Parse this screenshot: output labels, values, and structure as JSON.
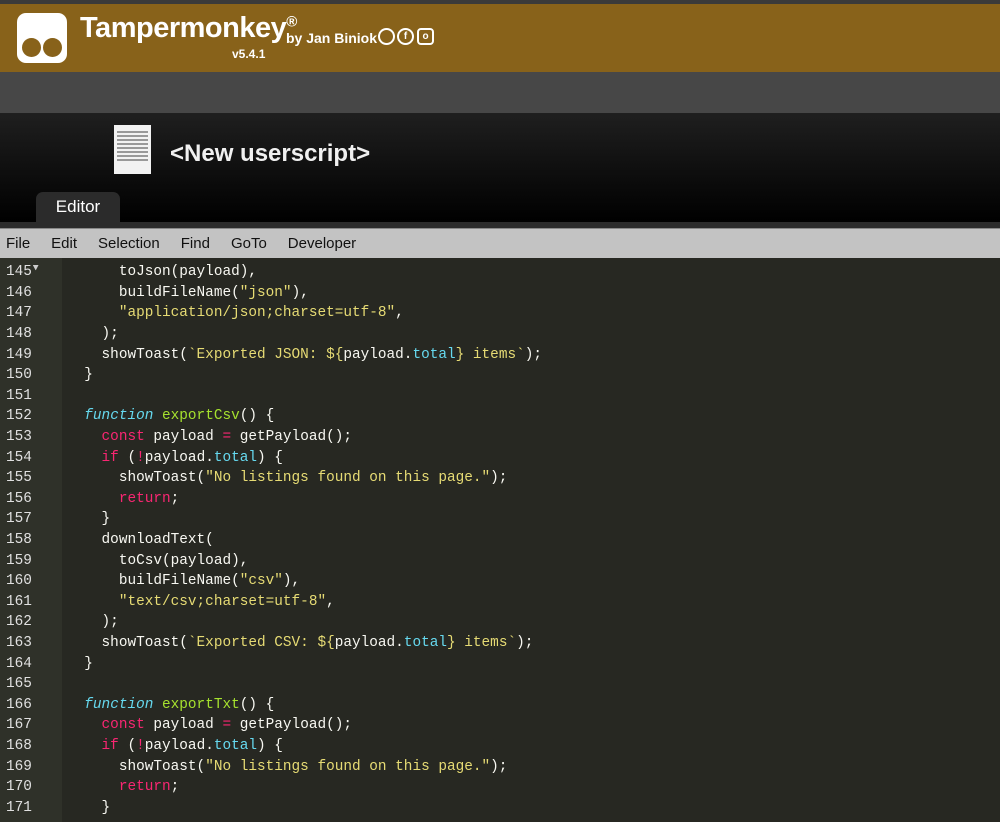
{
  "header": {
    "app_name": "Tampermonkey",
    "registered": "®",
    "byline": "by Jan Biniok",
    "version": "v5.4.1",
    "social": [
      "github-icon",
      "facebook-icon",
      "instagram-icon"
    ]
  },
  "script": {
    "name": "<New userscript>"
  },
  "tabs": [
    {
      "label": "Editor",
      "active": true
    }
  ],
  "menu": [
    "File",
    "Edit",
    "Selection",
    "Find",
    "GoTo",
    "Developer"
  ],
  "colors": {
    "header": "#88621a",
    "editor_bg": "#272822",
    "string": "#e6db74",
    "keyword": "#f92672",
    "function": "#a6e22e",
    "property": "#66d9ef"
  },
  "code": [
    {
      "n": "145",
      "i": 6,
      "t": [
        [
          "",
          "toJson(payload),"
        ]
      ]
    },
    {
      "n": "146",
      "i": 6,
      "t": [
        [
          "",
          "buildFileName("
        ],
        [
          "str",
          "\"json\""
        ],
        [
          "",
          "),"
        ]
      ]
    },
    {
      "n": "147",
      "i": 6,
      "t": [
        [
          "str",
          "\"application/json;charset=utf-8\""
        ],
        [
          "",
          ","
        ]
      ]
    },
    {
      "n": "148",
      "i": 4,
      "t": [
        [
          "",
          ");"
        ]
      ]
    },
    {
      "n": "149",
      "i": 4,
      "t": [
        [
          "",
          "showToast("
        ],
        [
          "str",
          "`Exported JSON: ${"
        ],
        [
          "",
          "payload."
        ],
        [
          "prop",
          "total"
        ],
        [
          "str",
          "} items`"
        ],
        [
          "",
          ");"
        ]
      ]
    },
    {
      "n": "150",
      "i": 2,
      "t": [
        [
          "",
          "}"
        ]
      ]
    },
    {
      "n": "151",
      "i": 0,
      "t": []
    },
    {
      "n": "152",
      "i": 2,
      "fold": true,
      "t": [
        [
          "fnkw",
          "function"
        ],
        [
          "",
          " "
        ],
        [
          "fn",
          "exportCsv"
        ],
        [
          "",
          "() {"
        ]
      ]
    },
    {
      "n": "153",
      "i": 4,
      "t": [
        [
          "kw",
          "const"
        ],
        [
          "",
          " payload "
        ],
        [
          "kw",
          "="
        ],
        [
          "",
          " getPayload();"
        ]
      ]
    },
    {
      "n": "154",
      "i": 4,
      "fold": true,
      "t": [
        [
          "kw",
          "if"
        ],
        [
          "",
          " ("
        ],
        [
          "kw",
          "!"
        ],
        [
          "",
          "payload."
        ],
        [
          "prop",
          "total"
        ],
        [
          "",
          ") {"
        ]
      ]
    },
    {
      "n": "155",
      "i": 6,
      "t": [
        [
          "",
          "showToast("
        ],
        [
          "str",
          "\"No listings found on this page.\""
        ],
        [
          "",
          ");"
        ]
      ]
    },
    {
      "n": "156",
      "i": 6,
      "t": [
        [
          "kw",
          "return"
        ],
        [
          "",
          ";"
        ]
      ]
    },
    {
      "n": "157",
      "i": 4,
      "t": [
        [
          "",
          "}"
        ]
      ]
    },
    {
      "n": "158",
      "i": 4,
      "t": [
        [
          "",
          "downloadText("
        ]
      ]
    },
    {
      "n": "159",
      "i": 6,
      "t": [
        [
          "",
          "toCsv(payload),"
        ]
      ]
    },
    {
      "n": "160",
      "i": 6,
      "t": [
        [
          "",
          "buildFileName("
        ],
        [
          "str",
          "\"csv\""
        ],
        [
          "",
          "),"
        ]
      ]
    },
    {
      "n": "161",
      "i": 6,
      "t": [
        [
          "str",
          "\"text/csv;charset=utf-8\""
        ],
        [
          "",
          ","
        ]
      ]
    },
    {
      "n": "162",
      "i": 4,
      "t": [
        [
          "",
          ");"
        ]
      ]
    },
    {
      "n": "163",
      "i": 4,
      "t": [
        [
          "",
          "showToast("
        ],
        [
          "str",
          "`Exported CSV: ${"
        ],
        [
          "",
          "payload."
        ],
        [
          "prop",
          "total"
        ],
        [
          "str",
          "} items`"
        ],
        [
          "",
          ");"
        ]
      ]
    },
    {
      "n": "164",
      "i": 2,
      "t": [
        [
          "",
          "}"
        ]
      ]
    },
    {
      "n": "165",
      "i": 0,
      "t": []
    },
    {
      "n": "166",
      "i": 2,
      "fold": true,
      "t": [
        [
          "fnkw",
          "function"
        ],
        [
          "",
          " "
        ],
        [
          "fn",
          "exportTxt"
        ],
        [
          "",
          "() {"
        ]
      ]
    },
    {
      "n": "167",
      "i": 4,
      "t": [
        [
          "kw",
          "const"
        ],
        [
          "",
          " payload "
        ],
        [
          "kw",
          "="
        ],
        [
          "",
          " getPayload();"
        ]
      ]
    },
    {
      "n": "168",
      "i": 4,
      "fold": true,
      "t": [
        [
          "kw",
          "if"
        ],
        [
          "",
          " ("
        ],
        [
          "kw",
          "!"
        ],
        [
          "",
          "payload."
        ],
        [
          "prop",
          "total"
        ],
        [
          "",
          ") {"
        ]
      ]
    },
    {
      "n": "169",
      "i": 6,
      "t": [
        [
          "",
          "showToast("
        ],
        [
          "str",
          "\"No listings found on this page.\""
        ],
        [
          "",
          ");"
        ]
      ]
    },
    {
      "n": "170",
      "i": 6,
      "t": [
        [
          "kw",
          "return"
        ],
        [
          "",
          ";"
        ]
      ]
    },
    {
      "n": "171",
      "i": 4,
      "t": [
        [
          "",
          "}"
        ]
      ]
    }
  ]
}
